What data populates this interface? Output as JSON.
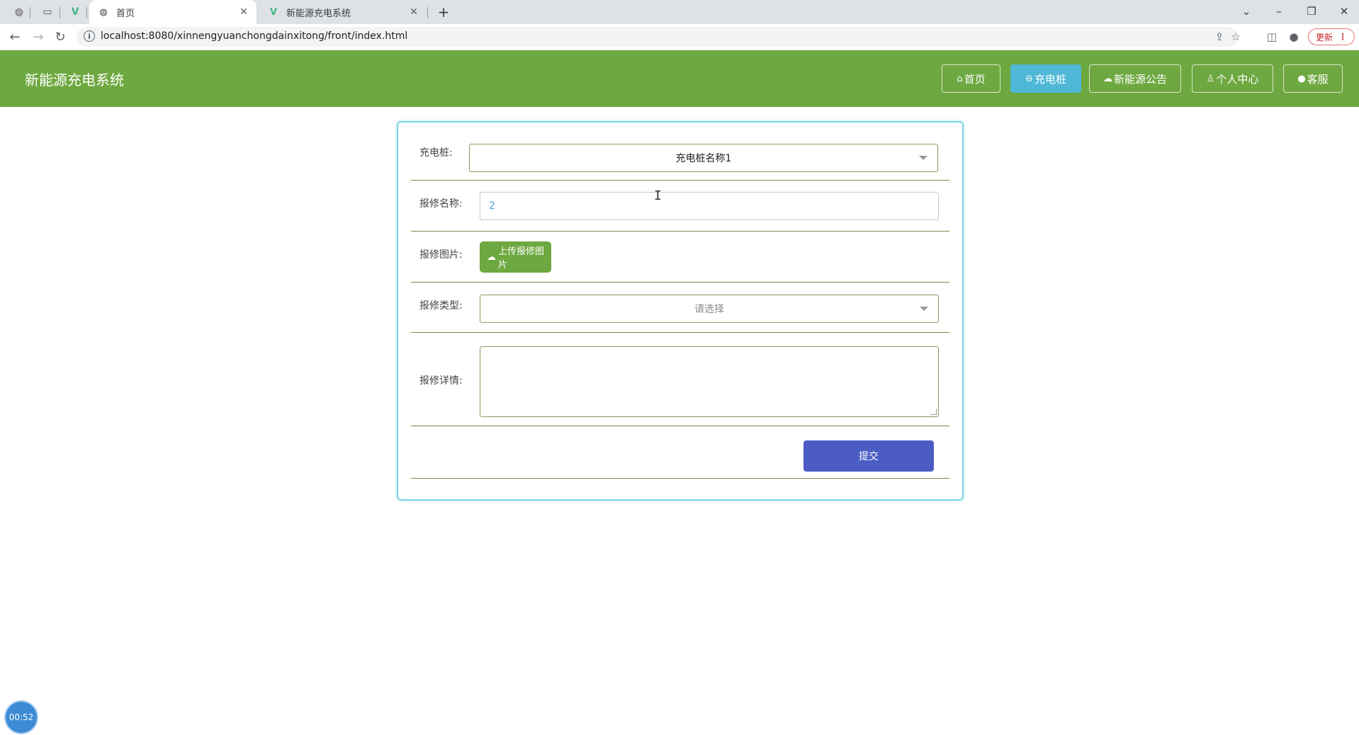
{
  "browser": {
    "tabs": [
      {
        "title": "首页",
        "active": true
      },
      {
        "title": "新能源充电系统",
        "active": false
      }
    ],
    "new_tab_symbol": "+",
    "url": "localhost:8080/xinnengyuanchongdainxitong/front/index.html",
    "update_label": "更新"
  },
  "header": {
    "brand": "新能源充电系统",
    "nav": {
      "home": "首页",
      "charging_pile": "充电桩",
      "news": "新能源公告",
      "profile": "个人中心",
      "service": "客服"
    },
    "active_nav": "charging_pile"
  },
  "form": {
    "pile_label": "充电桩:",
    "pile_value": "充电桩名称1",
    "repair_name_label": "报修名称:",
    "repair_name_value": "2",
    "repair_image_label": "报修图片:",
    "upload_label": "上传报修图片",
    "repair_type_label": "报修类型:",
    "repair_type_placeholder": "请选择",
    "repair_detail_label": "报修详情:",
    "repair_detail_value": "",
    "submit_label": "提交"
  },
  "timer": "00:52",
  "colors": {
    "header_bg": "#6ea840",
    "nav_active": "#4fb8d6",
    "card_border": "#7dd3e3",
    "submit_bg": "#4a5cc4",
    "upload_bg": "#6ea840"
  },
  "icons": [
    "chrome-globe-icon",
    "vue-logo-icon",
    "back-arrow-icon",
    "forward-arrow-icon",
    "reload-icon",
    "info-icon",
    "share-icon",
    "star-icon",
    "sidebar-icon",
    "profile-icon",
    "home-icon",
    "plug-icon",
    "cloud-icon",
    "user-icon",
    "headset-icon",
    "cloud-upload-icon"
  ]
}
